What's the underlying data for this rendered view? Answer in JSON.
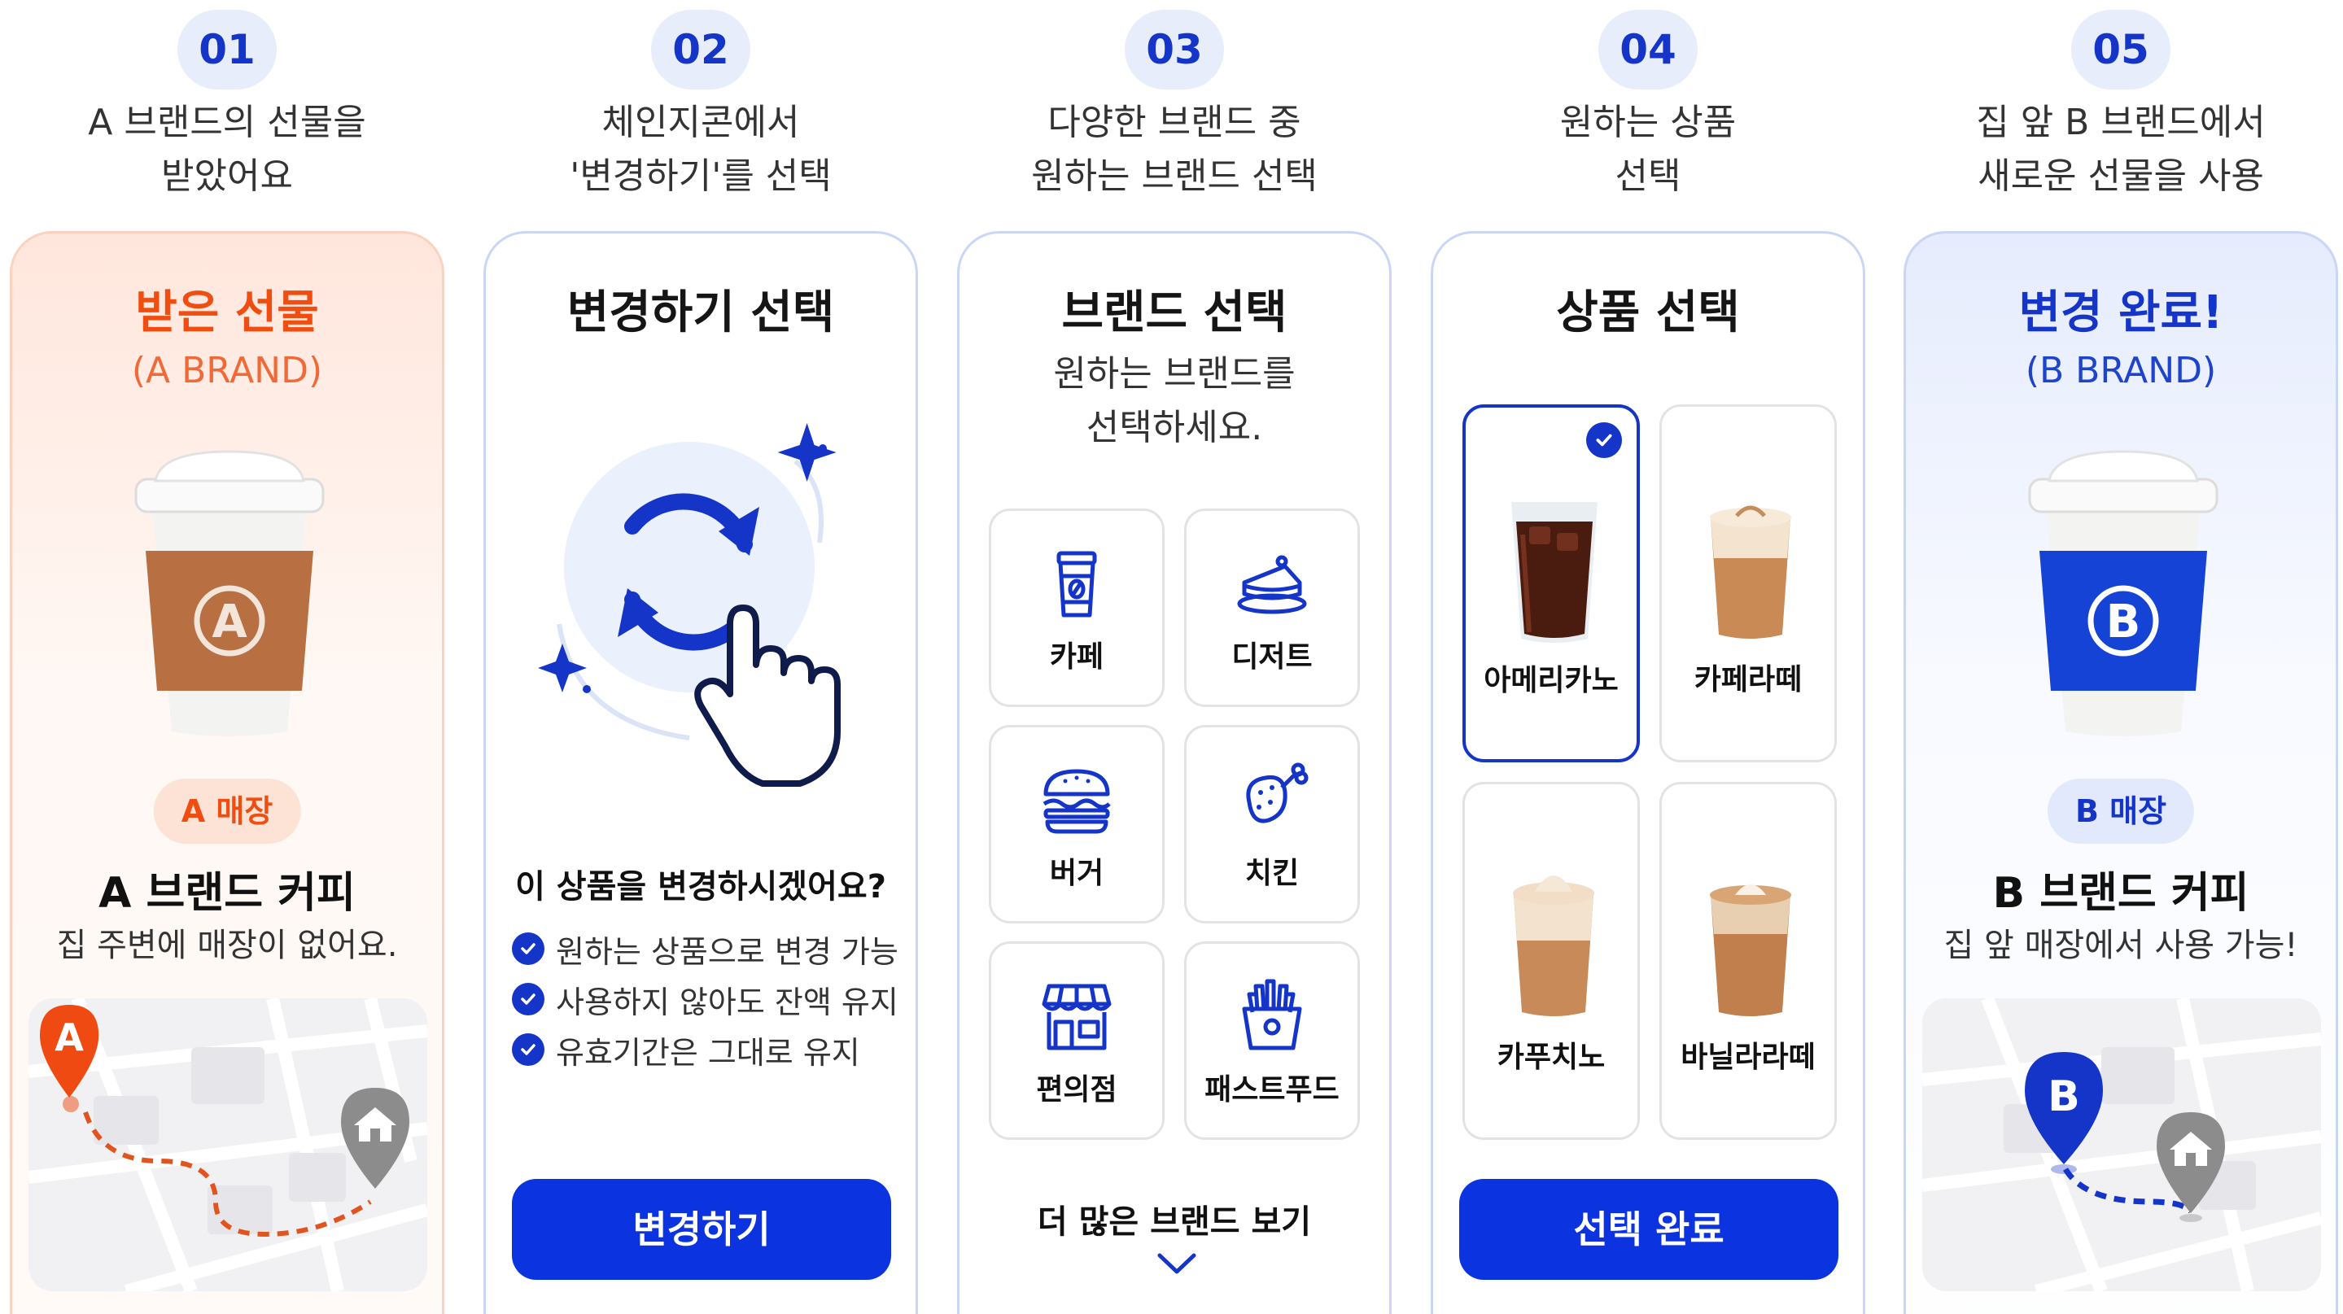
{
  "colors": {
    "accent_blue": "#0b33e0",
    "accent_orange": "#f04d10",
    "badge_bg": "#e8edfb"
  },
  "steps": [
    {
      "number": "01",
      "line1": "A 브랜드의 선물을",
      "line2": "받았어요"
    },
    {
      "number": "02",
      "line1": "체인지콘에서",
      "line2": "'변경하기'를 선택"
    },
    {
      "number": "03",
      "line1": "다양한 브랜드 중",
      "line2": "원하는 브랜드 선택"
    },
    {
      "number": "04",
      "line1": "원하는 상품",
      "line2": "선택"
    },
    {
      "number": "05",
      "line1": "집 앞 B 브랜드에서",
      "line2": "새로운 선물을 사용"
    }
  ],
  "card1": {
    "title": "받은 선물",
    "subtitle": "(A BRAND)",
    "cup_letter": "A",
    "store_pill": "A 매장",
    "brand_name": "A 브랜드 커피",
    "description": "집 주변에 매장이 없어요.",
    "map_pin": "A"
  },
  "card2": {
    "title": "변경하기 선택",
    "question": "이 상품을 변경하시겠어요?",
    "checks": [
      "원하는 상품으로 변경 가능",
      "사용하지 않아도 잔액 유지",
      "유효기간은 그대로 유지"
    ],
    "button": "변경하기"
  },
  "card3": {
    "title": "브랜드 선택",
    "subtitle_line1": "원하는 브랜드를",
    "subtitle_line2": "선택하세요.",
    "categories": [
      {
        "label": "카페",
        "icon": "coffee-cup-icon"
      },
      {
        "label": "디저트",
        "icon": "cake-icon"
      },
      {
        "label": "버거",
        "icon": "burger-icon"
      },
      {
        "label": "치킨",
        "icon": "chicken-icon"
      },
      {
        "label": "편의점",
        "icon": "store-icon"
      },
      {
        "label": "패스트푸드",
        "icon": "fries-icon"
      }
    ],
    "more": "더 많은 브랜드 보기"
  },
  "card4": {
    "title": "상품 선택",
    "products": [
      {
        "label": "아메리카노",
        "selected": true
      },
      {
        "label": "카페라떼",
        "selected": false
      },
      {
        "label": "카푸치노",
        "selected": false
      },
      {
        "label": "바닐라라떼",
        "selected": false
      }
    ],
    "button": "선택 완료"
  },
  "card5": {
    "title": "변경 완료!",
    "subtitle": "(B BRAND)",
    "cup_letter": "B",
    "store_pill": "B 매장",
    "brand_name": "B 브랜드 커피",
    "description": "집 앞 매장에서 사용 가능!",
    "map_pin": "B"
  }
}
